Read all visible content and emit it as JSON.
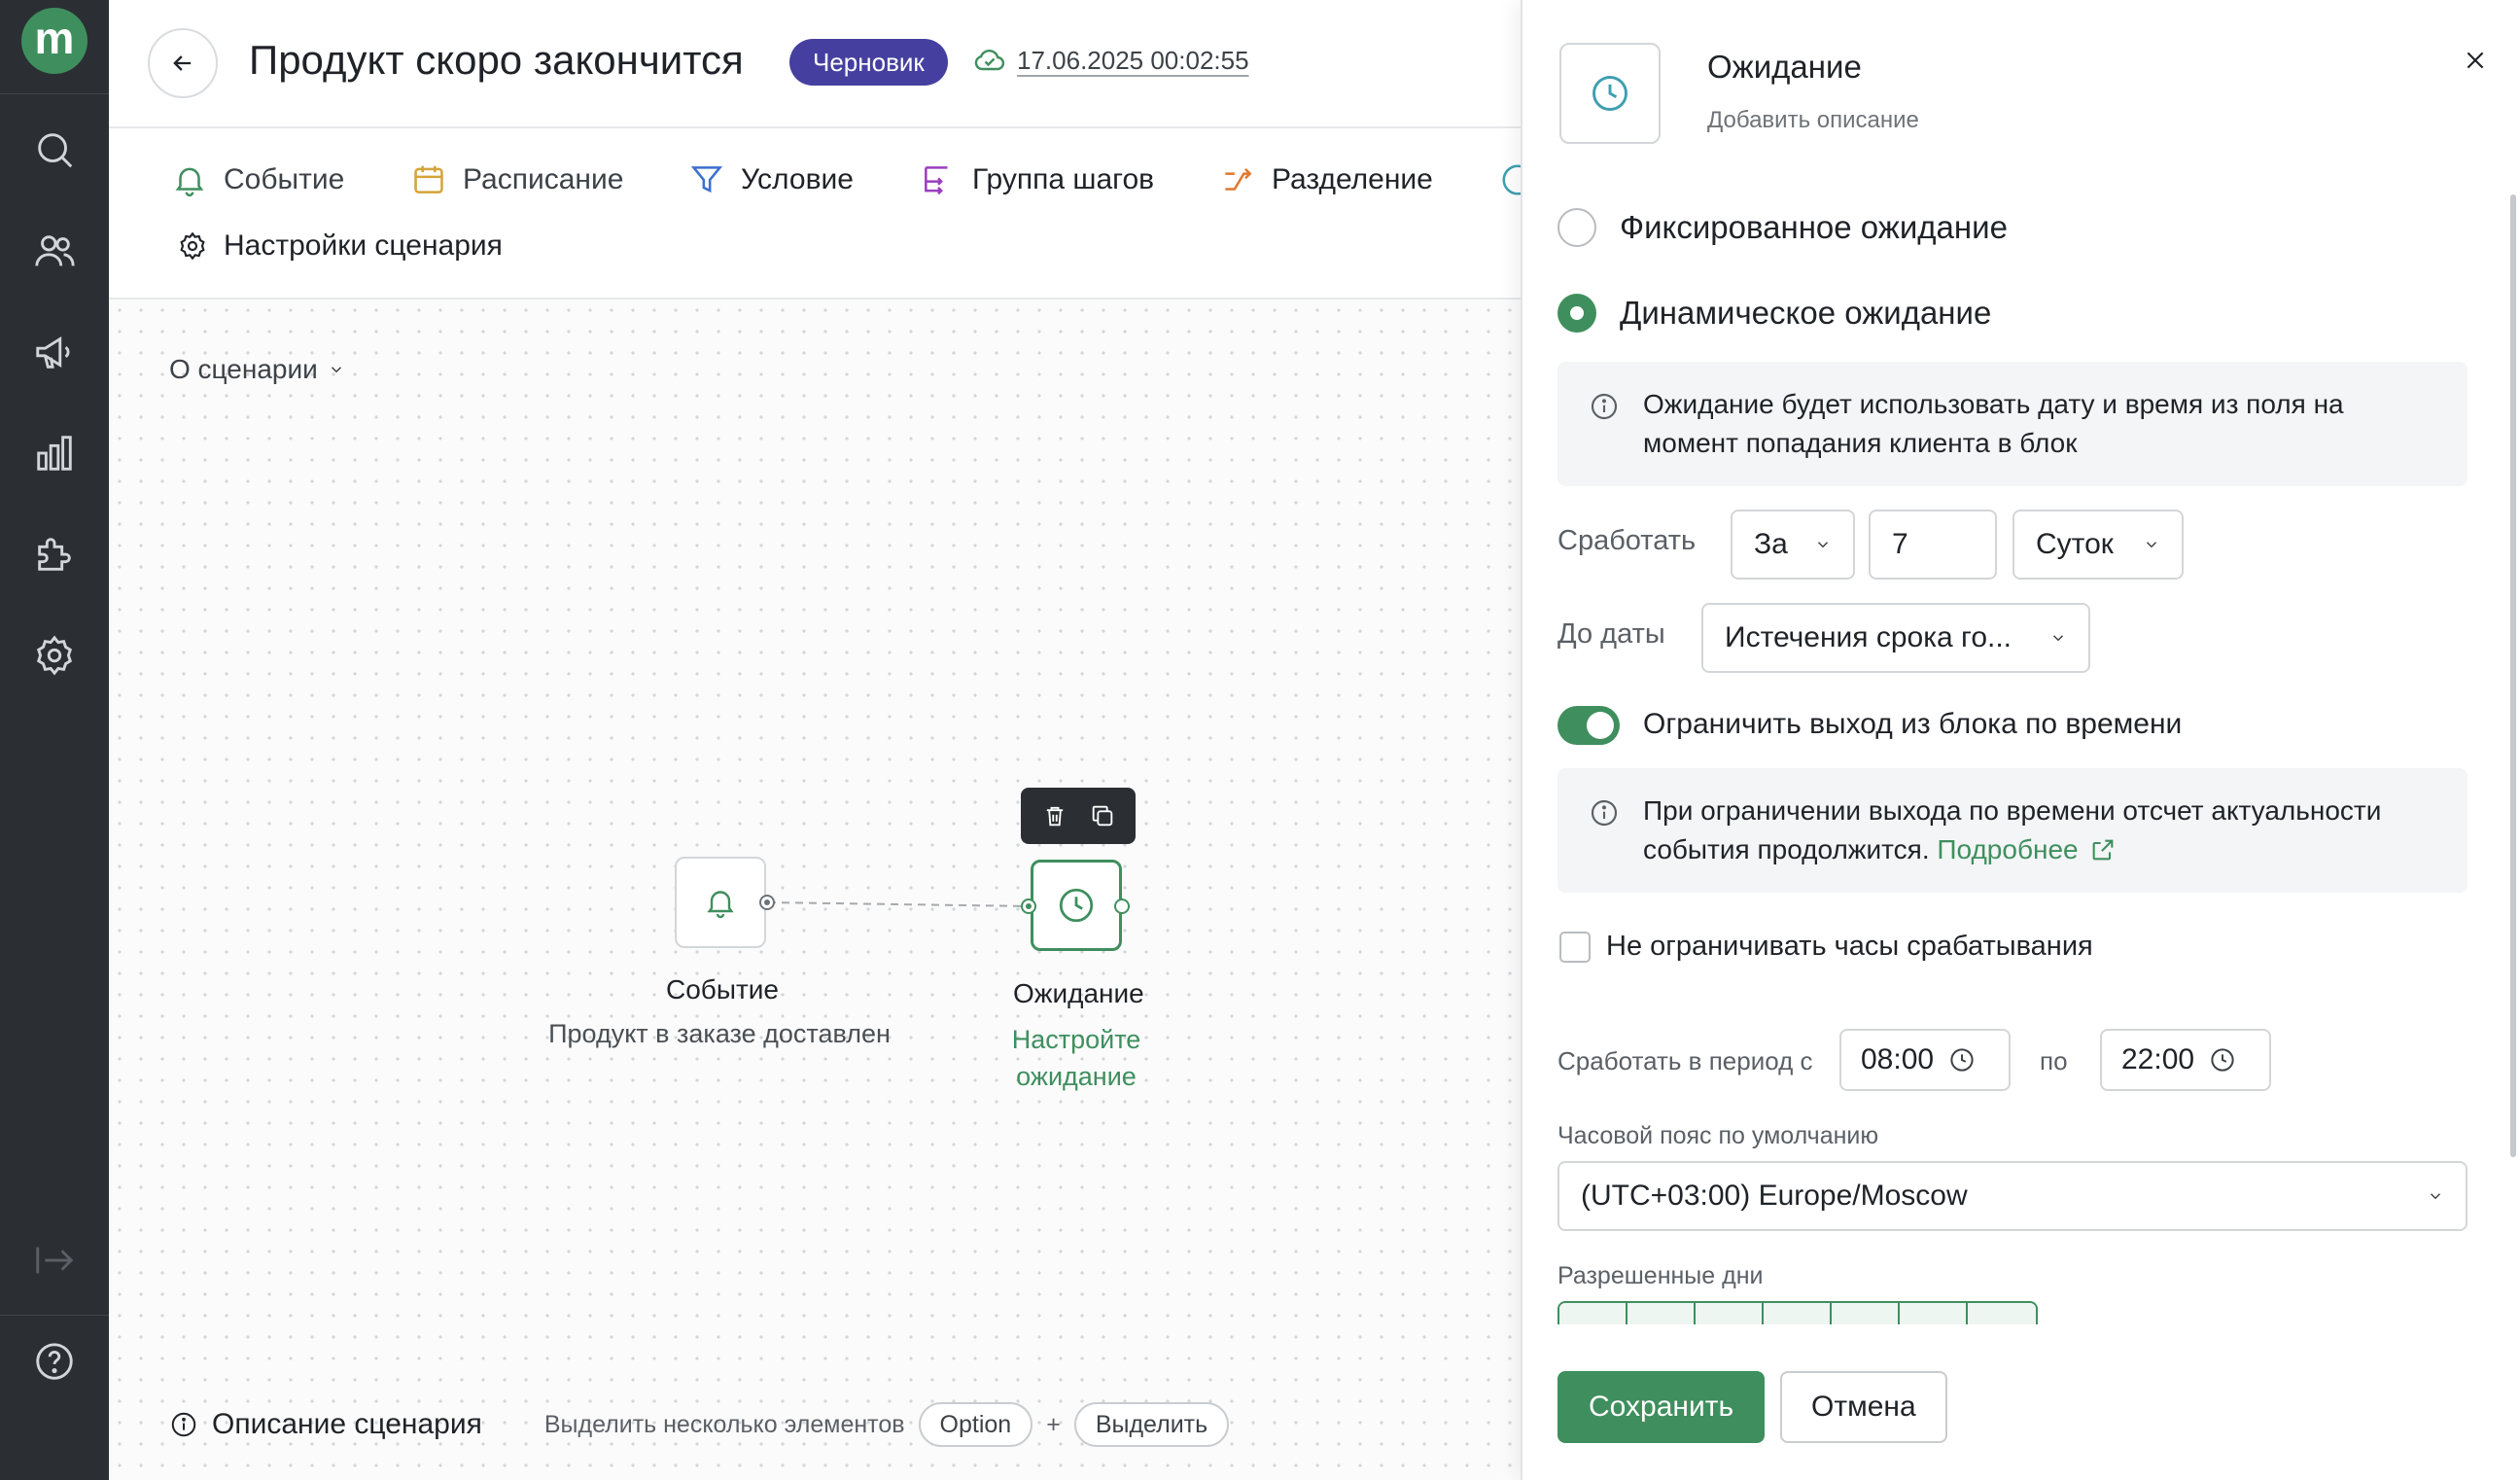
{
  "app": {
    "logo_letter": "m"
  },
  "sidebar": {
    "items": [
      {
        "icon": "search-icon"
      },
      {
        "icon": "users-icon"
      },
      {
        "icon": "megaphone-icon"
      },
      {
        "icon": "analytics-icon"
      },
      {
        "icon": "integrations-puzzle-icon"
      },
      {
        "icon": "settings-gear-icon"
      },
      {
        "icon": "collapse-sidebar-icon"
      },
      {
        "icon": "help-icon"
      }
    ]
  },
  "header": {
    "title": "Продукт скоро закончится",
    "status_badge": "Черновик",
    "saved_at": "17.06.2025 00:02:55"
  },
  "toolbar": {
    "items": [
      {
        "label": "Событие",
        "icon": "bell-icon"
      },
      {
        "label": "Расписание",
        "icon": "calendar-icon"
      },
      {
        "label": "Условие",
        "icon": "filter-icon"
      },
      {
        "label": "Группа шагов",
        "icon": "step-group-icon"
      },
      {
        "label": "Разделение",
        "icon": "split-icon"
      }
    ],
    "settings_label": "Настройки сценария"
  },
  "canvas": {
    "about_label": "О сценарии",
    "nodes": [
      {
        "title": "Событие",
        "subtitle": "Продукт в заказе доставлен",
        "icon": "bell-icon"
      },
      {
        "title": "Ожидание",
        "subtitle": "Настройте ожидание",
        "icon": "clock-icon"
      }
    ],
    "bottom": {
      "description_label": "Описание сценария",
      "multi_select_hint": "Выделить несколько элементов",
      "key_option": "Option",
      "plus": "+",
      "key_select": "Выделить"
    }
  },
  "panel": {
    "title": "Ожидание",
    "description_placeholder": "Добавить описание",
    "radio_fixed": "Фиксированное ожидание",
    "radio_dynamic": "Динамическое ожидание",
    "selected_mode": "dynamic",
    "info_dynamic": "Ожидание будет использовать дату и время из поля на момент попадания клиента в блок",
    "trigger_label": "Сработать",
    "trigger_direction": "За",
    "trigger_amount": "7",
    "trigger_unit": "Суток",
    "until_date_label": "До даты",
    "until_date_value": "Истечения срока го...",
    "limit_exit_label": "Ограничить выход из блока по времени",
    "limit_exit_enabled": true,
    "info_limit_text": "При ограничении выхода по времени отсчет актуальности события продолжится.",
    "info_limit_link": "Подробнее",
    "no_hour_limit_label": "Не ограничивать часы срабатывания",
    "no_hour_limit_checked": false,
    "period_label": "Сработать в период с",
    "period_from": "08:00",
    "period_to_label": "по",
    "period_to": "22:00",
    "timezone_label": "Часовой пояс по умолчанию",
    "timezone_value": "(UTC+03:00) Europe/Moscow",
    "allowed_days_label": "Разрешенные дни",
    "save_label": "Сохранить",
    "cancel_label": "Отмена"
  },
  "colors": {
    "accent": "#3f8f5e",
    "badge": "#45409f",
    "sidebar": "#2b2f33"
  }
}
